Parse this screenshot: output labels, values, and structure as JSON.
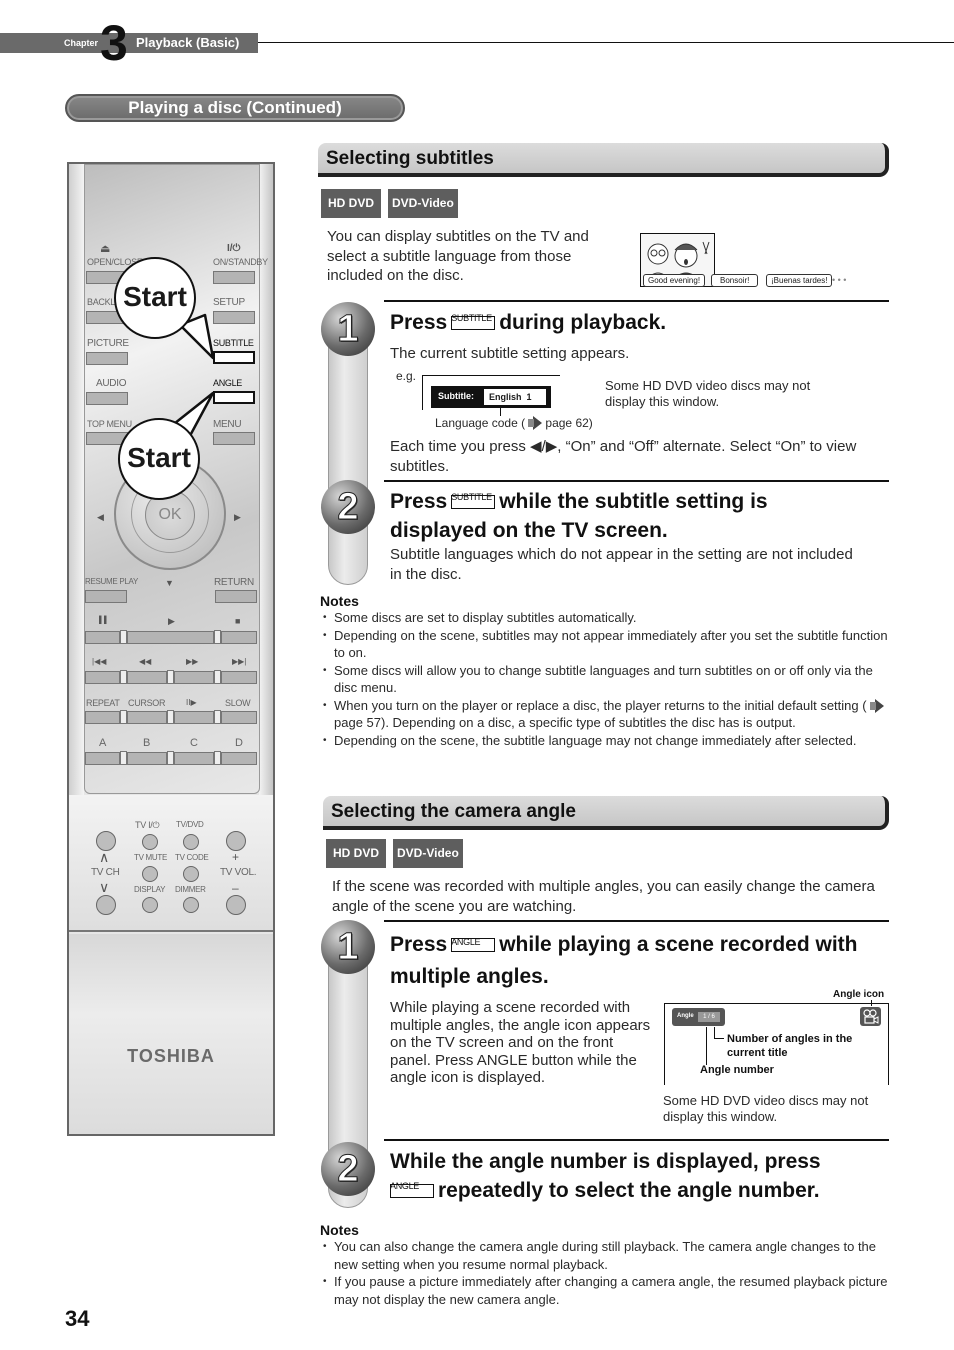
{
  "chapter": {
    "word": "Chapter",
    "number": "3",
    "title": "Playback (Basic)"
  },
  "section_title": "Playing a disc (Continued)",
  "remote": {
    "brand": "TOSHIBA",
    "callout_label": "Start",
    "labels": {
      "open_close": "OPEN/CLOSE",
      "on_standby": "ON/STANDBY",
      "backlight": "BACKLI",
      "setup": "SETUP",
      "picture": "PICTURE",
      "subtitle": "SUBTITLE",
      "audio": "AUDIO",
      "angle": "ANGLE",
      "top_menu": "TOP MENU",
      "menu": "MENU",
      "ok": "OK",
      "resume_play": "RESUME PLAY",
      "return": "RETURN",
      "repeat": "REPEAT",
      "cursor": "CURSOR",
      "slow": "SLOW",
      "a": "A",
      "b": "B",
      "c": "C",
      "d": "D",
      "tv_power": "TV  I/⏻",
      "tv_dvd": "TV/DVD",
      "tv_mute": "TV MUTE",
      "tv_code": "TV CODE",
      "display": "DISPLAY",
      "dimmer": "DIMMER",
      "tv_ch": "TV CH",
      "tv_vol": "TV VOL.",
      "plus": "+",
      "minus": "–",
      "eject_glyph": "⏏",
      "power_glyph": "I/⏻",
      "pause_glyph": "▌▌",
      "play_glyph": "▶",
      "stop_glyph": "■",
      "prev_glyph": "|◀◀",
      "rew_glyph": "◀◀",
      "ff_glyph": "▶▶",
      "next_glyph": "▶▶|",
      "step_glyph": "II▶",
      "up_glyph": "∧",
      "down_glyph": "∨"
    }
  },
  "subtitles": {
    "heading": "Selecting subtitles",
    "badges": [
      "HD DVD",
      "DVD-Video"
    ],
    "intro": "You can display subtitles on the TV and select a subtitle language from those included on the disc.",
    "illustration_bubbles": [
      "Good evening!",
      "Bonsoir!",
      "¡Buenas tardes!"
    ],
    "ellipsis": "•  •  •",
    "step1": {
      "num": "1",
      "pre": "Press",
      "key": "SUBTITLE",
      "post": "during playback.",
      "desc": "The current subtitle setting appears.",
      "eg": "e.g.",
      "osd_label": "Subtitle:",
      "osd_value": "English  1",
      "lang_code_pre": "Language code (",
      "lang_code_post": " page 62)",
      "side_note": "Some HD DVD video discs may not display this window.",
      "after": "Each time you press ◀/▶, “On” and “Off” alternate. Select “On” to view subtitles."
    },
    "step2": {
      "num": "2",
      "pre": "Press",
      "key": "SUBTITLE",
      "post": "while the subtitle setting is",
      "line2": "displayed on the TV screen.",
      "desc": "Subtitle languages which do not appear in the setting are not included in the disc."
    },
    "notes_title": "Notes",
    "notes": [
      "Some discs are set to display subtitles automatically.",
      "Depending on the scene, subtitles may not appear immediately after you set the subtitle function to on.",
      "Some discs will allow you to change subtitle languages and turn subtitles on or off only via the disc menu.",
      "When you turn on the player or replace a disc, the player returns to the initial default setting (",
      "Depending on the scene, the subtitle language may not change immediately after selected."
    ],
    "note4_rest": " page 57). Depending on a disc, a specific type of subtitles the disc has is output."
  },
  "angle": {
    "heading": "Selecting the camera angle",
    "badges": [
      "HD DVD",
      "DVD-Video"
    ],
    "intro": "If the scene was recorded with multiple angles, you can easily change the camera angle of the scene you are watching.",
    "step1": {
      "num": "1",
      "pre": "Press",
      "key": "ANGLE",
      "post": "while playing a scene recorded with",
      "line2": "multiple angles.",
      "desc": "While playing a scene recorded with multiple angles, the angle icon appears on the TV screen and on the front panel. Press ANGLE button while the angle icon is displayed.",
      "angle_icon_label": "Angle icon",
      "osd_label": "Angle",
      "osd_value": "1 / 6",
      "num_angles_label": "Number of angles in the current title",
      "angle_number_label": "Angle number",
      "side_note": "Some HD DVD video discs may not display this window."
    },
    "step2": {
      "num": "2",
      "line1": "While the angle number is displayed, press",
      "key": "ANGLE",
      "post": "repeatedly to select the angle number."
    },
    "notes_title": "Notes",
    "notes": [
      "You can also change the camera angle during still playback. The camera angle changes to the new setting when you resume normal playback.",
      "If you pause a picture immediately after changing a camera angle, the resumed playback picture may not display the new camera angle."
    ]
  },
  "page_number": "34"
}
